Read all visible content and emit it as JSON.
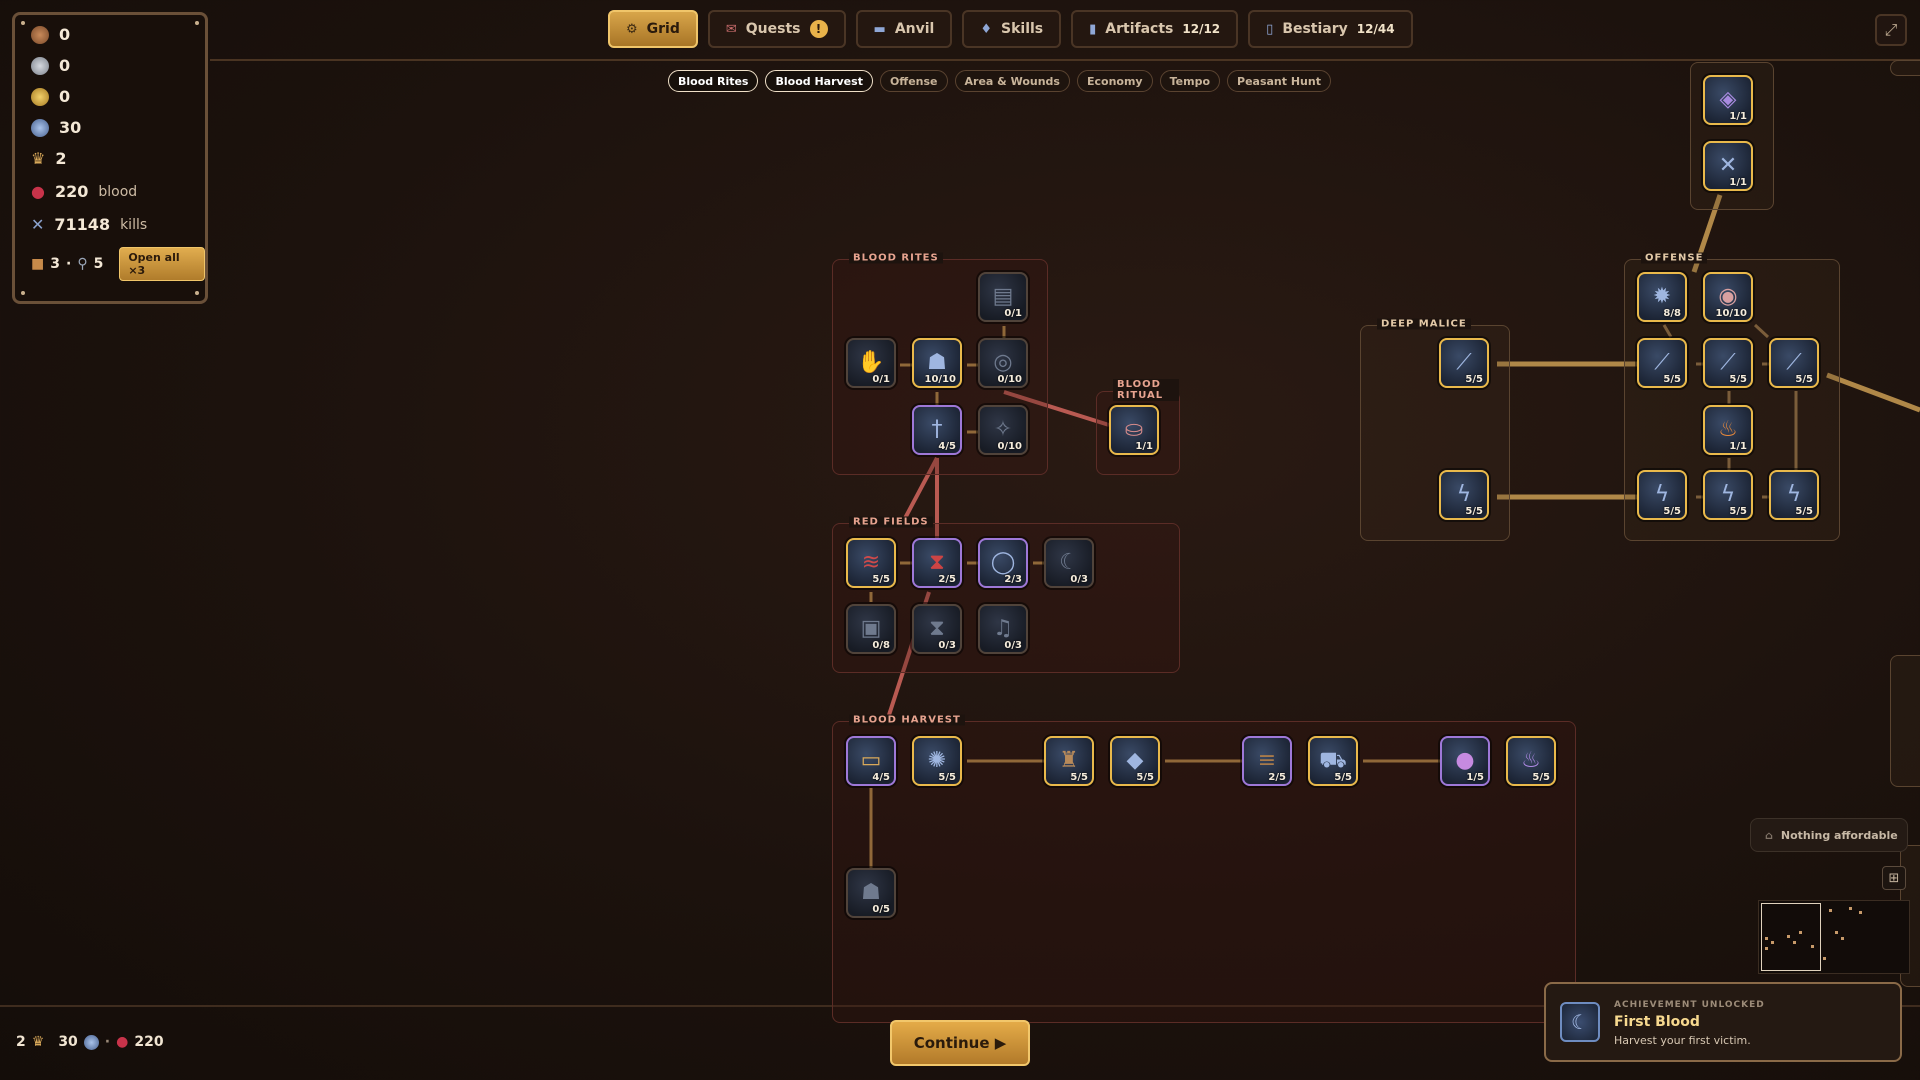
{
  "tabs": [
    {
      "label": "Grid",
      "icon": "gear-icon",
      "active": true
    },
    {
      "label": "Quests",
      "icon": "scroll-icon",
      "badge": "!"
    },
    {
      "label": "Anvil",
      "icon": "anvil-icon"
    },
    {
      "label": "Skills",
      "icon": "flame-icon"
    },
    {
      "label": "Artifacts",
      "icon": "artifact-icon",
      "count": "12/12"
    },
    {
      "label": "Bestiary",
      "icon": "book-icon",
      "count": "12/44"
    }
  ],
  "filters": [
    "Blood Rites",
    "Blood Harvest",
    "Offense",
    "Area & Wounds",
    "Economy",
    "Tempo",
    "Peasant Hunt"
  ],
  "active_filters": [
    "Blood Rites",
    "Blood Harvest"
  ],
  "resources": {
    "copper": "0",
    "silver": "0",
    "gold": "0",
    "gems": "30",
    "crowns": "2",
    "blood": "220",
    "blood_label": "blood",
    "kills": "71148",
    "kills_label": "kills",
    "chests": "3",
    "keys": "5",
    "open_all": "Open all ×3"
  },
  "groups": {
    "blood_rites": "BLOOD RITES",
    "blood_ritual": "BLOOD RITUAL",
    "red_fields": "RED FIELDS",
    "blood_harvest": "BLOOD HARVEST",
    "deep_malice": "DEEP MALICE",
    "offense": "OFFENSE"
  },
  "nodes": {
    "br1": "0/1",
    "br2": "0/1",
    "br3": "10/10",
    "br4": "0/10",
    "br5": "4/5",
    "br6": "0/10",
    "ritual": "1/1",
    "rf1": "5/5",
    "rf2": "2/5",
    "rf3": "2/3",
    "rf4": "0/3",
    "rf5": "0/8",
    "rf6": "0/3",
    "rf7": "0/3",
    "bh1": "4/5",
    "bh2": "5/5",
    "bh3": "5/5",
    "bh4": "5/5",
    "bh5": "2/5",
    "bh6": "5/5",
    "bh7": "1/5",
    "bh8": "5/5",
    "bh9": "0/5",
    "top1": "1/1",
    "top2": "1/1",
    "off1": "8/8",
    "off2": "10/10",
    "off3": "5/5",
    "off4": "5/5",
    "off5": "5/5",
    "off6": "1/1",
    "off7": "5/5",
    "off8": "5/5",
    "off9": "5/5",
    "dm1": "5/5",
    "dm2": "5/5"
  },
  "nothing_affordable": "Nothing affordable",
  "achievement": {
    "kicker": "ACHIEVEMENT UNLOCKED",
    "title": "First Blood",
    "desc": "Harvest your first victim."
  },
  "bottom": {
    "crowns": "2",
    "gems": "30",
    "sep": "·",
    "blood": "220"
  },
  "continue_label": "Continue ▶"
}
